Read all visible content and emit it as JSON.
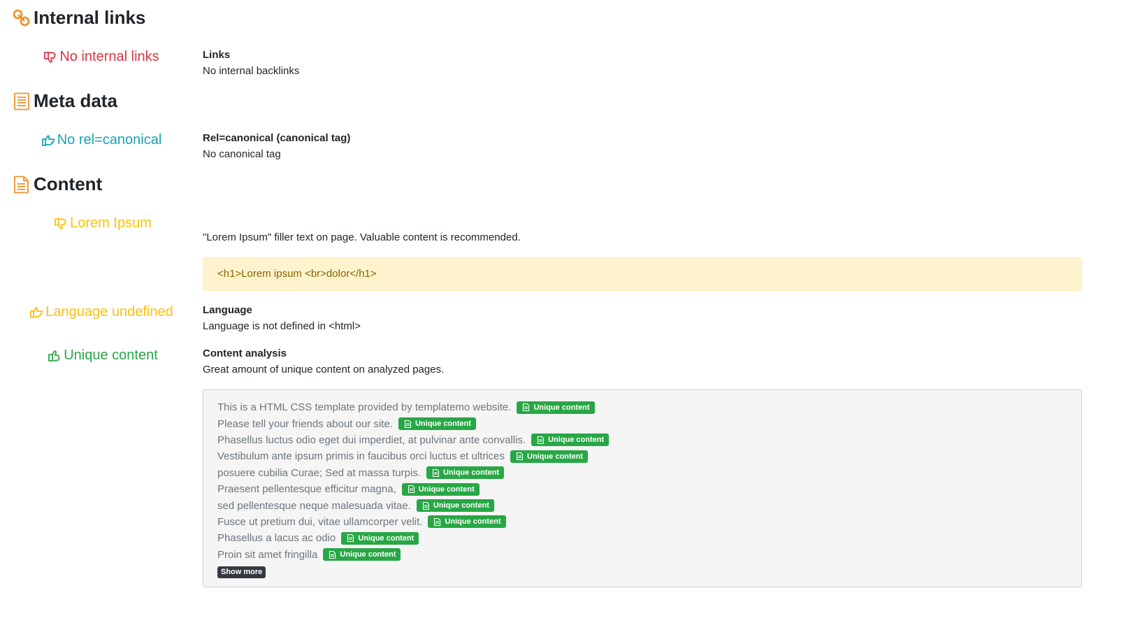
{
  "sections": {
    "internal_links": {
      "title": "Internal links",
      "status_text": "No internal links",
      "detail_label": "Links",
      "detail_text": "No internal backlinks"
    },
    "meta_data": {
      "title": "Meta data",
      "status_text": "No rel=canonical",
      "detail_label": "Rel=canonical (canonical tag)",
      "detail_text": "No canonical tag"
    },
    "content": {
      "title": "Content",
      "lorem": {
        "status_text": "Lorem Ipsum",
        "detail_text": "\"Lorem Ipsum\" filler text on page. Valuable content is recommended.",
        "code": "<h1>Lorem ipsum <br>dolor</h1>"
      },
      "language": {
        "status_text": "Language undefined",
        "detail_label": "Language",
        "detail_text": "Language is not defined in <html>"
      },
      "unique": {
        "status_text": "Unique content",
        "detail_label": "Content analysis",
        "detail_text": "Great amount of unique content on analyzed pages.",
        "badge_label": "Unique content",
        "show_more": "Show more",
        "lines": [
          "This is a HTML CSS template provided by templatemo website.",
          "Please tell your friends about our site.",
          "Phasellus luctus odio eget dui imperdiet, at pulvinar ante convallis.",
          "Vestibulum ante ipsum primis in faucibus orci luctus et ultrices",
          "posuere cubilia Curae; Sed at massa turpis.",
          "Praesent pellentesque efficitur magna,",
          "sed pellentesque neque malesuada vitae.",
          "Fusce ut pretium dui, vitae ullamcorper velit.",
          "Phasellus a lacus ac odio",
          "Proin sit amet fringilla"
        ]
      }
    }
  },
  "icons": {
    "internal_links": "link-icon",
    "meta_data": "document-list-icon",
    "content": "document-icon",
    "no_internal_links": "thumbs-down-icon",
    "no_canonical": "hand-pointing-right-icon",
    "lorem_ipsum": "thumbs-down-icon",
    "language": "hand-pointing-right-icon",
    "unique": "thumbs-up-icon",
    "badge": "file-icon"
  },
  "colors": {
    "orange": "#f0932b",
    "red": "#dc3545",
    "teal": "#17a2b8",
    "yellow": "#ffc107",
    "green": "#28a745"
  }
}
